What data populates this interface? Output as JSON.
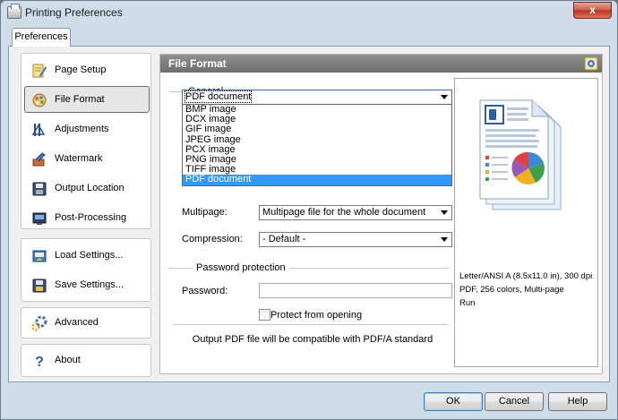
{
  "window": {
    "title": "Printing Preferences",
    "close_glyph": "x"
  },
  "tab": {
    "label": "Preferences"
  },
  "nav": {
    "group1": [
      {
        "label": "Page Setup",
        "icon": "page-setup-icon"
      },
      {
        "label": "File Format",
        "icon": "file-format-icon",
        "selected": true
      },
      {
        "label": "Adjustments",
        "icon": "adjustments-icon"
      },
      {
        "label": "Watermark",
        "icon": "watermark-icon"
      },
      {
        "label": "Output Location",
        "icon": "output-location-icon"
      },
      {
        "label": "Post-Processing",
        "icon": "post-processing-icon"
      }
    ],
    "group2": [
      {
        "label": "Load Settings...",
        "icon": "load-settings-icon"
      },
      {
        "label": "Save Settings...",
        "icon": "save-settings-icon"
      }
    ],
    "group3": [
      {
        "label": "Advanced",
        "icon": "advanced-icon"
      }
    ],
    "group4": [
      {
        "label": "About",
        "icon": "about-icon"
      }
    ]
  },
  "panel": {
    "title": "File Format",
    "general_label": "General",
    "format_value": "PDF document",
    "format_options": [
      "BMP image",
      "DCX image",
      "GIF image",
      "JPEG image",
      "PCX image",
      "PNG image",
      "TIFF image",
      "PDF document"
    ],
    "multipage_label": "Multipage:",
    "multipage_value": "Multipage file for the whole document",
    "compression_label": "Compression:",
    "compression_value": "- Default -",
    "password_section_label": "Password protection",
    "password_label": "Password:",
    "password_value": "",
    "protect_label": "Protect from opening",
    "protect_checked": false,
    "footer_note": "Output PDF file will be compatible with PDF/A standard"
  },
  "preview": {
    "line1": "Letter/ANSI A (8.5x11.0 in), 300 dpi",
    "line2": "PDF, 256 colors, Multi-page",
    "line3": "Run"
  },
  "buttons": {
    "ok": "OK",
    "cancel": "Cancel",
    "help": "Help"
  },
  "colors": {
    "panel_header": "#7f7f7f",
    "selection": "#3399ff",
    "window_frame": "#cfdcea"
  }
}
